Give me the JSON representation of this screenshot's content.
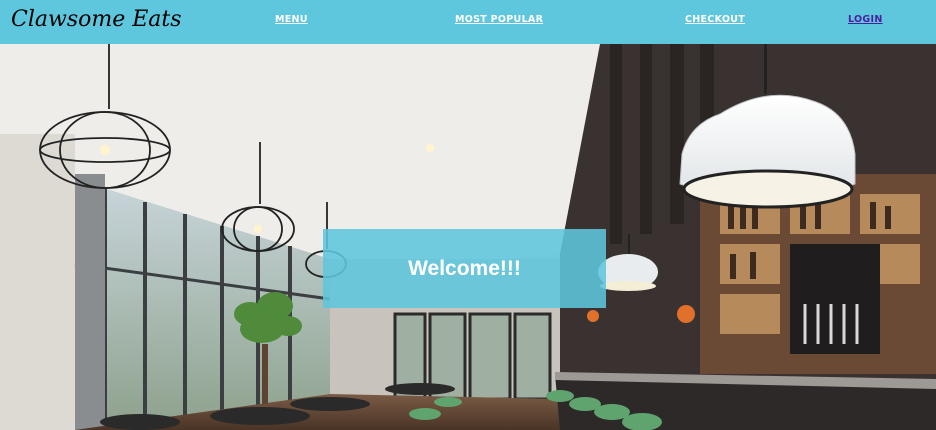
{
  "brand": {
    "name": "Clawsome Eats"
  },
  "nav": {
    "menu": "MENU",
    "most_popular": "MOST POPULAR",
    "checkout": "CHECKOUT",
    "login": "LOGIN"
  },
  "hero": {
    "welcome": "Welcome!!!"
  },
  "colors": {
    "navbar": "#5ec6dd",
    "nav_link": "#ffffff",
    "login_link": "#4a1fa0",
    "welcome_box": "#5ec6dd"
  }
}
